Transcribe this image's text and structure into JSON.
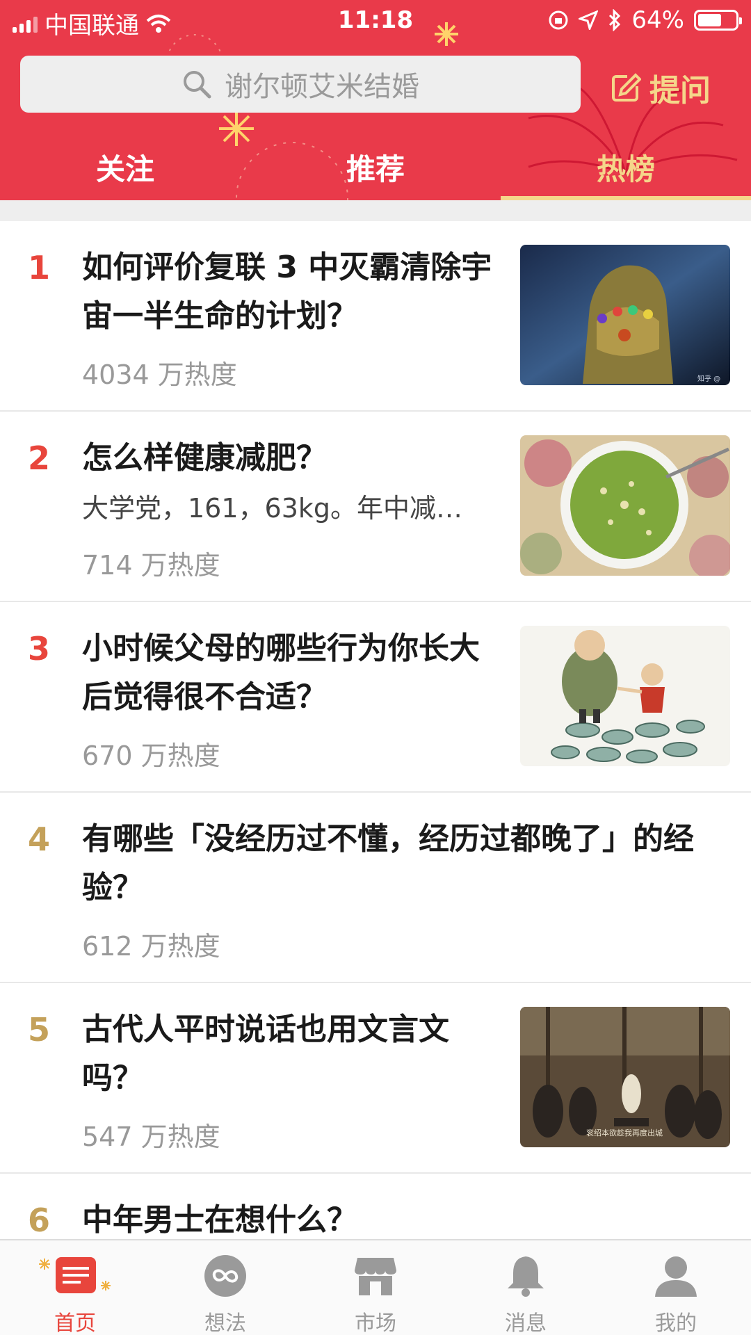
{
  "status_bar": {
    "carrier": "中国联通",
    "time": "11:18",
    "battery": "64%",
    "battery_level": 0.64
  },
  "search": {
    "placeholder": "谢尔顿艾米结婚"
  },
  "ask_button": "提问",
  "tabs": [
    {
      "label": "关注",
      "active": false
    },
    {
      "label": "推荐",
      "active": false
    },
    {
      "label": "热榜",
      "active": true
    }
  ],
  "hot_list": [
    {
      "rank": "1",
      "title": "如何评价复联 3 中灭霸清除宇宙一半生命的计划？",
      "excerpt": "",
      "heat": "4034 万热度",
      "thumb": "gauntlet-image"
    },
    {
      "rank": "2",
      "title": "怎么样健康减肥？",
      "excerpt": "大学党，161，63kg。年中减…",
      "heat": "714 万热度",
      "thumb": "green-soup-image"
    },
    {
      "rank": "3",
      "title": "小时候父母的哪些行为你长大后觉得很不合适？",
      "excerpt": "",
      "heat": "670 万热度",
      "thumb": "cartoon-parent-child-image"
    },
    {
      "rank": "4",
      "title": "有哪些「没经历过不懂，经历过都晚了」的经验？",
      "excerpt": "",
      "heat": "612 万热度",
      "thumb": ""
    },
    {
      "rank": "5",
      "title": "古代人平时说话也用文言文吗？",
      "excerpt": "",
      "heat": "547 万热度",
      "thumb": "drama-scene-image"
    },
    {
      "rank": "6",
      "title": "中年男士在想什么？",
      "excerpt": "",
      "heat": "",
      "thumb": ""
    }
  ],
  "bottom_nav": [
    {
      "label": "首页",
      "icon": "home-icon",
      "active": true
    },
    {
      "label": "想法",
      "icon": "ideas-icon",
      "active": false
    },
    {
      "label": "市场",
      "icon": "market-icon",
      "active": false
    },
    {
      "label": "消息",
      "icon": "bell-icon",
      "active": false
    },
    {
      "label": "我的",
      "icon": "profile-icon",
      "active": false
    }
  ],
  "colors": {
    "header_red": "#e93a4a",
    "accent_gold": "#f5d68a",
    "rank_red": "#e8453c",
    "rank_gold": "#c4a15a"
  }
}
